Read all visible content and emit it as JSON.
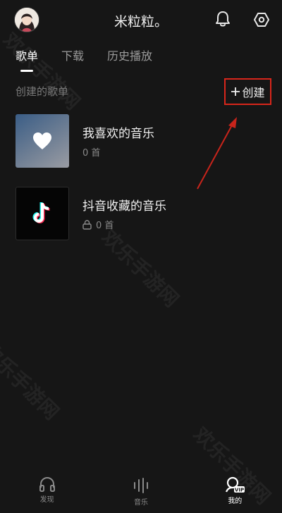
{
  "header": {
    "title": "米粒粒。"
  },
  "tabs": [
    {
      "label": "歌单"
    },
    {
      "label": "下载"
    },
    {
      "label": "历史播放"
    }
  ],
  "section": {
    "label": "创建的歌单",
    "create_label": "创建"
  },
  "playlists": [
    {
      "title": "我喜欢的音乐",
      "count": "0 首",
      "locked": false
    },
    {
      "title": "抖音收藏的音乐",
      "count": "0 首",
      "locked": true
    }
  ],
  "bottom_nav": [
    {
      "label": "发现",
      "icon": "headphones-icon"
    },
    {
      "label": "音乐",
      "icon": "equalizer-icon"
    },
    {
      "label": "我的",
      "icon": "profile-vip-icon"
    }
  ],
  "watermark": "欢乐手游网",
  "colors": {
    "accent_highlight": "#d8261b",
    "background": "#161616"
  }
}
